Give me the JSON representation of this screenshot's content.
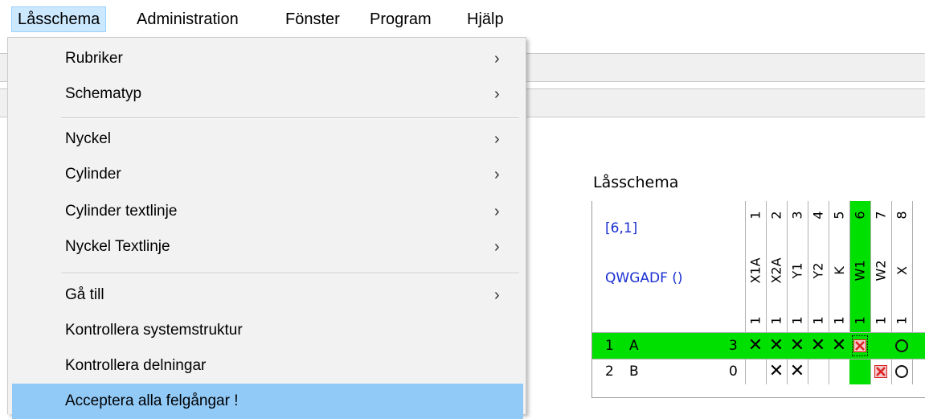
{
  "menubar": {
    "items": [
      "Låsschema",
      "Administration",
      "Fönster",
      "Program",
      "Hjälp"
    ],
    "active": "Låsschema"
  },
  "dropdown": {
    "groups": [
      [
        {
          "label": "Rubriker",
          "submenu": true
        },
        {
          "label": "Schematyp",
          "submenu": true
        }
      ],
      [
        {
          "label": "Nyckel",
          "submenu": true
        },
        {
          "label": "Cylinder",
          "submenu": true
        },
        {
          "label": "Cylinder textlinje",
          "submenu": true
        },
        {
          "label": "Nyckel Textlinje",
          "submenu": true
        }
      ],
      [
        {
          "label": "Gå till",
          "submenu": true
        },
        {
          "label": "Kontrollera systemstruktur",
          "submenu": false
        },
        {
          "label": "Kontrollera delningar",
          "submenu": false
        },
        {
          "label": "Acceptera alla felgångar !",
          "submenu": false,
          "highlighted": true
        }
      ]
    ],
    "arrow_glyph": "›"
  },
  "lock_schedule": {
    "title": "Låsschema",
    "position": "[6,1]",
    "system": "QWGADF ()",
    "columns": [
      {
        "num": "1",
        "name": "X1A",
        "count": "1"
      },
      {
        "num": "2",
        "name": "X2A",
        "count": "1"
      },
      {
        "num": "3",
        "name": "Y1",
        "count": "1"
      },
      {
        "num": "4",
        "name": "Y2",
        "count": "1"
      },
      {
        "num": "5",
        "name": "K",
        "count": "1"
      },
      {
        "num": "6",
        "name": "W1",
        "count": "1",
        "highlighted": true
      },
      {
        "num": "7",
        "name": "W2",
        "count": "1"
      },
      {
        "num": "8",
        "name": "X",
        "count": "1"
      }
    ],
    "rows": [
      {
        "num": "1",
        "name": "A",
        "count": "3",
        "highlighted": true,
        "cells": [
          "X",
          "X",
          "X",
          "X",
          "X",
          "R",
          "",
          "O"
        ]
      },
      {
        "num": "2",
        "name": "B",
        "count": "0",
        "highlighted": false,
        "cells": [
          "",
          "X",
          "X",
          "",
          "",
          "",
          "R",
          "O"
        ]
      }
    ]
  },
  "colors": {
    "highlight_green": "#00e000",
    "menu_active": "#cce8ff",
    "item_highlight": "#91c9f7",
    "info_blue": "#1a2fd1",
    "red_mark": "#dd2222"
  }
}
